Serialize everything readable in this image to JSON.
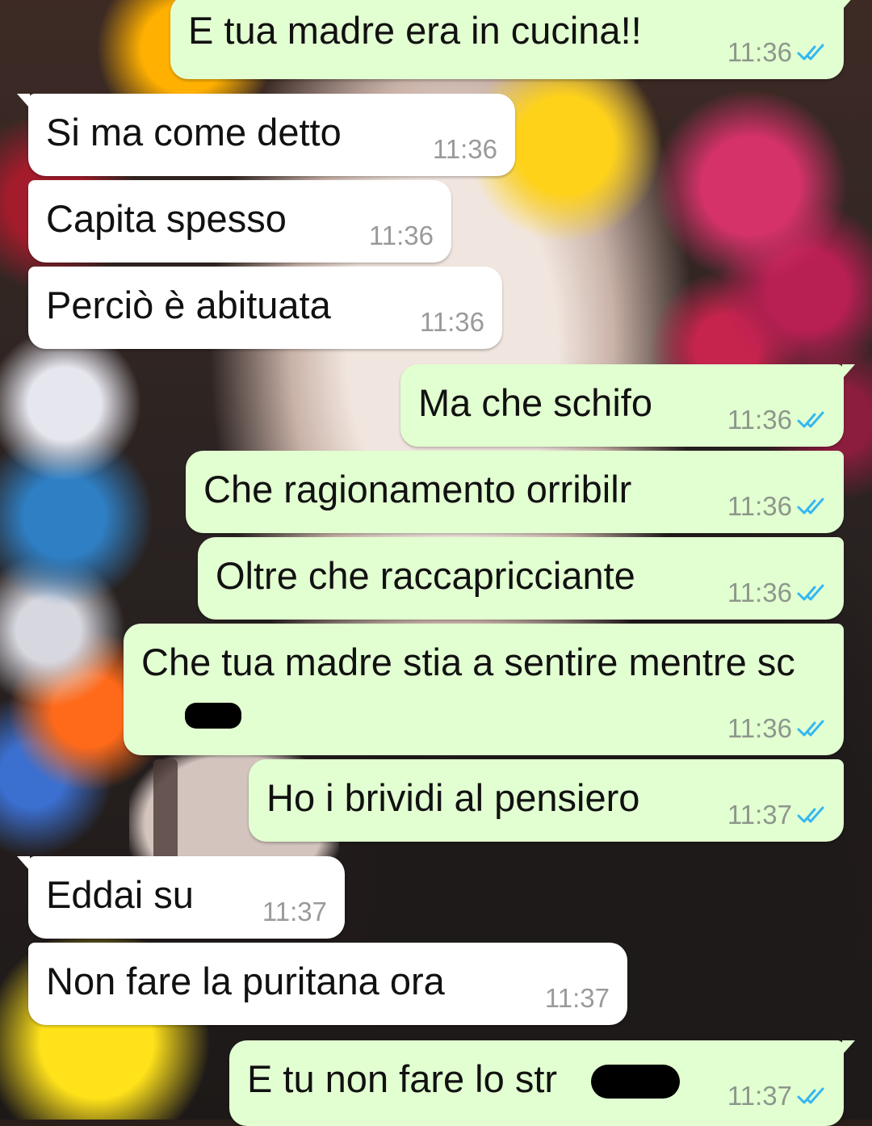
{
  "colors": {
    "outgoing_bubble": "#e2ffd1",
    "incoming_bubble": "#ffffff",
    "time_text": "#8d978b",
    "read_ticks": "#34b7f1"
  },
  "icons": {
    "read_receipt": "double-check-icon"
  },
  "messages": [
    {
      "direction": "out",
      "text": "E tua madre era in cucina!!",
      "time": "11:36",
      "status": "read"
    },
    {
      "direction": "in",
      "text": "Si ma come detto",
      "time": "11:36"
    },
    {
      "direction": "in",
      "text": "Capita spesso",
      "time": "11:36"
    },
    {
      "direction": "in",
      "text": "Perciò è abituata",
      "time": "11:36"
    },
    {
      "direction": "out",
      "text": "Ma che schifo",
      "time": "11:36",
      "status": "read"
    },
    {
      "direction": "out",
      "text": "Che ragionamento orribilr",
      "time": "11:36",
      "status": "read"
    },
    {
      "direction": "out",
      "text": "Oltre che raccapricciante",
      "time": "11:36",
      "status": "read"
    },
    {
      "direction": "out",
      "text": "Che tua madre stia a sentire mentre sc",
      "time": "11:36",
      "status": "read",
      "redacted": true
    },
    {
      "direction": "out",
      "text": "Ho i brividi al pensiero",
      "time": "11:37",
      "status": "read"
    },
    {
      "direction": "in",
      "text": "Eddai su",
      "time": "11:37"
    },
    {
      "direction": "in",
      "text": "Non fare la puritana ora",
      "time": "11:37"
    },
    {
      "direction": "out",
      "text": "E tu non fare lo str",
      "time": "11:37",
      "status": "read",
      "redacted": true
    }
  ]
}
